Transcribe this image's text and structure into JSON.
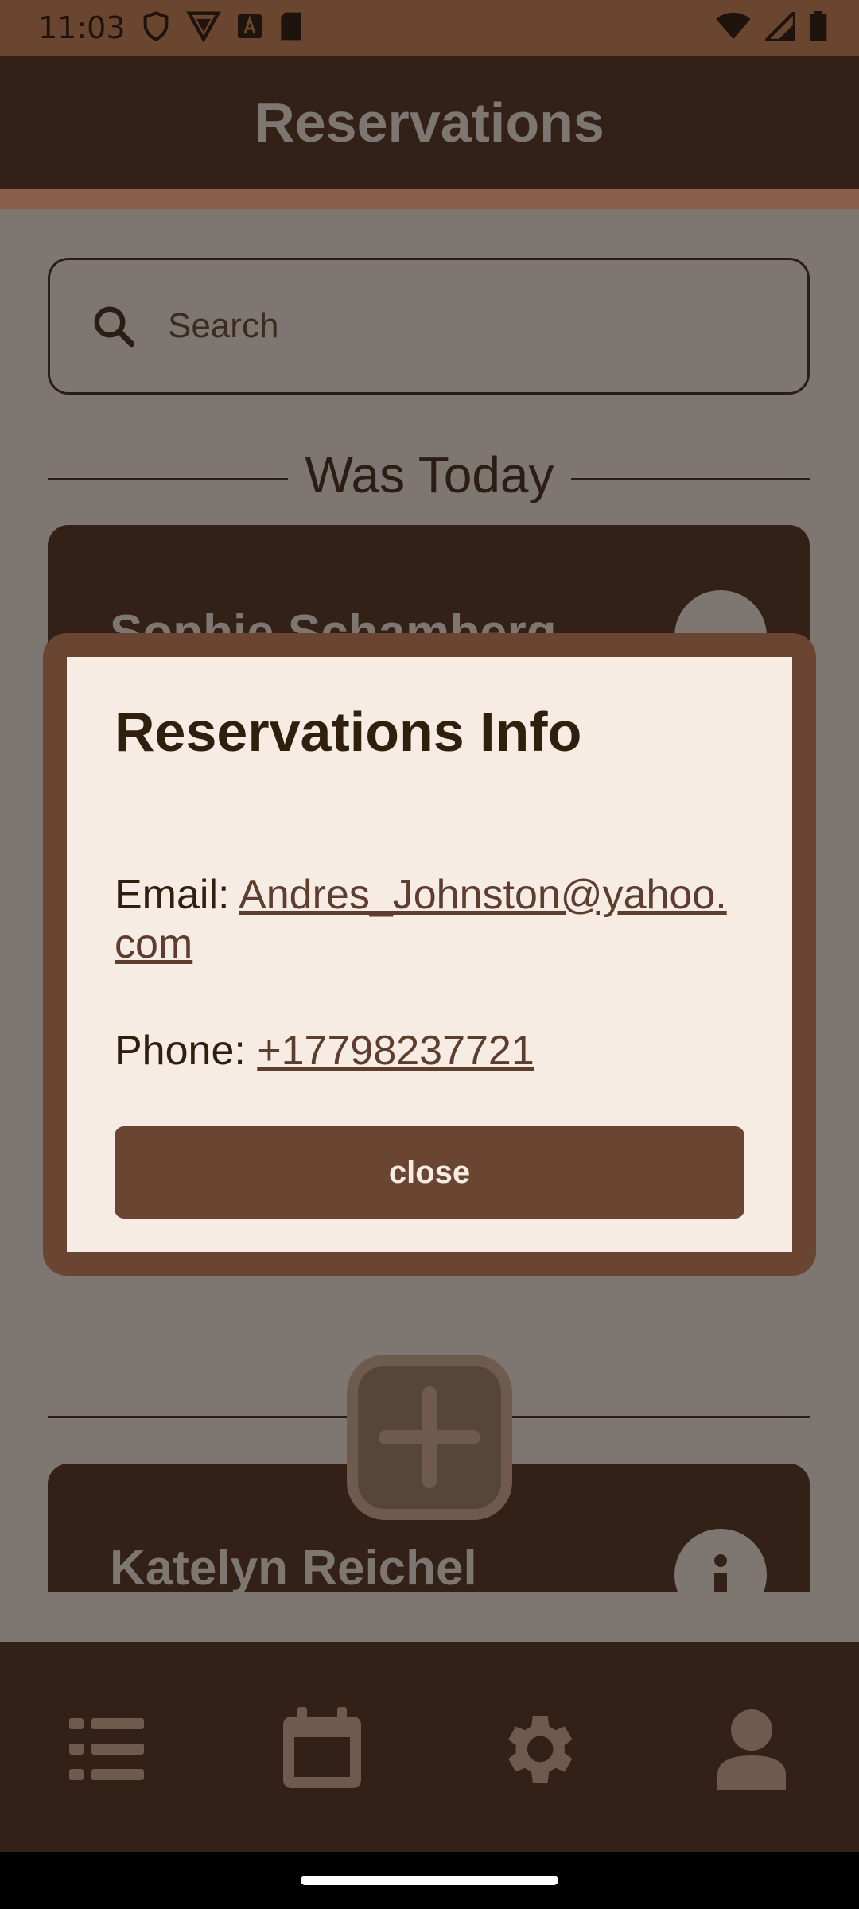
{
  "status_bar": {
    "time": "11:03"
  },
  "header": {
    "title": "Reservations"
  },
  "search": {
    "placeholder": "Search"
  },
  "section": {
    "title": "Was Today"
  },
  "cards": [
    {
      "name": "Sophie Schamberg"
    },
    {
      "name": "Katelyn Reichel"
    }
  ],
  "dialog": {
    "title": "Reservations Info",
    "email_label": "Email:",
    "email_value": "Andres_Johnston@yahoo.com",
    "phone_label": "Phone:",
    "phone_value": "+17798237721",
    "close_label": "close"
  },
  "bottom_nav": {
    "items": [
      {
        "icon": "list-icon"
      },
      {
        "icon": "calendar-icon"
      },
      {
        "icon": "gear-icon"
      },
      {
        "icon": "person-icon"
      }
    ]
  },
  "colors": {
    "header_bg": "#332118",
    "accent": "#6a4632",
    "dialog_bg": "#f6ece4",
    "scrim": "#7e7771"
  }
}
